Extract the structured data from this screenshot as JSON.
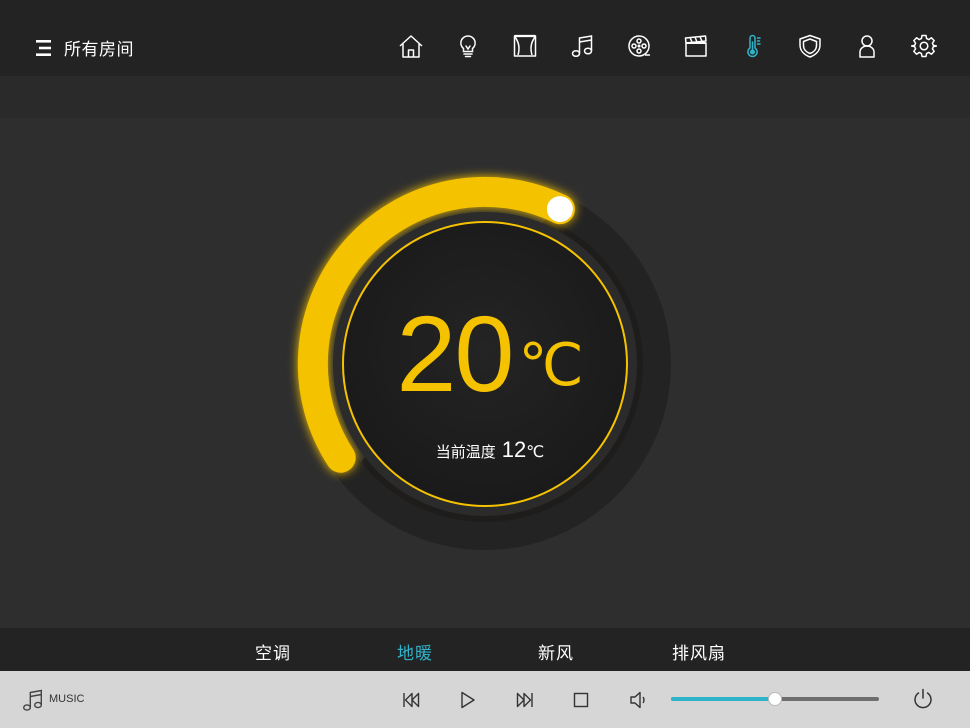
{
  "header": {
    "room_label": "所有房间",
    "nav_icons": [
      "home-icon",
      "bulb-icon",
      "curtain-icon",
      "music-icon",
      "film-reel-icon",
      "clapperboard-icon",
      "thermometer-icon",
      "shield-icon",
      "user-icon",
      "gear-icon"
    ],
    "active_nav": "thermometer-icon"
  },
  "thermostat": {
    "set_temp": "20",
    "set_unit": "℃",
    "current_label": "当前温度",
    "current_temp": "12",
    "current_unit": "℃",
    "level_fraction": 0.62
  },
  "tabs": [
    {
      "label": "空调",
      "active": false
    },
    {
      "label": "地暖",
      "active": true
    },
    {
      "label": "新风",
      "active": false
    },
    {
      "label": "排风扇",
      "active": false
    }
  ],
  "player": {
    "music_label": "MUSIC",
    "volume_fraction": 0.5
  },
  "colors": {
    "accent_yellow": "#f5c200",
    "accent_cyan": "#2fb3c9",
    "topbar": "#232323",
    "background": "#2e2e2e",
    "player_bar": "#d6d6d6"
  }
}
